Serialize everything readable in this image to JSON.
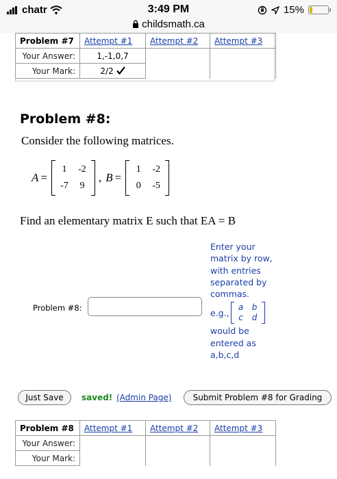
{
  "status_bar": {
    "carrier": "chatr",
    "time": "3:49 PM",
    "battery": "15%",
    "battery_level": 0.15,
    "url": "childsmath.ca",
    "icons": [
      "signal-icon",
      "wifi-icon",
      "lock-icon",
      "orientation-lock-icon",
      "location-icon",
      "battery-icon"
    ]
  },
  "problem7_table": {
    "header": "Problem #7",
    "attempts": [
      "Attempt #1",
      "Attempt #2",
      "Attempt #3"
    ],
    "answer_label": "Your Answer:",
    "answer_value": "1,-1,0,7",
    "mark_label": "Your Mark:",
    "mark_value": "2/2"
  },
  "problem8": {
    "title": "Problem #8:",
    "intro": "Consider the following matrices.",
    "matrix_a_name": "A",
    "matrix_a": [
      "1",
      "-2",
      "-7",
      "9"
    ],
    "matrix_b_name": "B",
    "matrix_b": [
      "1",
      "-2",
      "0",
      "-5"
    ],
    "question": "Find an elementary matrix E such that EA = B",
    "answer_label": "Problem #8:",
    "answer_value": "",
    "hint_top": "Enter your matrix by row, with entries separated by commas.",
    "hint_eg": "e.g.,",
    "hint_example": [
      "a",
      "b",
      "c",
      "d"
    ],
    "hint_bottom": "would be entered as a,b,c,d"
  },
  "actions": {
    "just_save": "Just Save",
    "saved": "saved!",
    "admin_page": "(Admin Page)",
    "submit": "Submit Problem #8 for Grading"
  },
  "problem8_table": {
    "header": "Problem #8",
    "attempts": [
      "Attempt #1",
      "Attempt #2",
      "Attempt #3"
    ],
    "answer_label": "Your Answer:",
    "mark_label": "Your Mark:"
  },
  "colors": {
    "link": "#1a3ea8",
    "saved": "#1f8a1f",
    "battery": "#e0b300"
  }
}
